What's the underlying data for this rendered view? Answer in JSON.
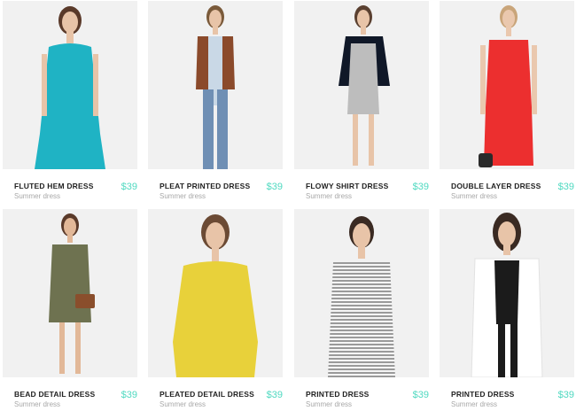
{
  "products": [
    {
      "name": "FLUTED HEM DRESS",
      "subtitle": "Summer dress",
      "price": "$39",
      "dress_color": "#1fb3c4"
    },
    {
      "name": "PLEAT PRINTED DRESS",
      "subtitle": "Summer dress",
      "price": "$39",
      "dress_color": "#8b4a2b"
    },
    {
      "name": "FLOWY SHIRT DRESS",
      "subtitle": "Summer dress",
      "price": "$39",
      "dress_color": "#bdbdbd"
    },
    {
      "name": "DOUBLE LAYER DRESS",
      "subtitle": "Summer dress",
      "price": "$39",
      "dress_color": "#ec2f2f"
    },
    {
      "name": "BEAD DETAIL DRESS",
      "subtitle": "Summer dress",
      "price": "$39",
      "dress_color": "#6e7250"
    },
    {
      "name": "PLEATED DETAIL DRESS",
      "subtitle": "Summer dress",
      "price": "$39",
      "dress_color": "#e8d13a"
    },
    {
      "name": "PRINTED DRESS",
      "subtitle": "Summer dress",
      "price": "$39",
      "dress_color": "#d6d6d6"
    },
    {
      "name": "PRINTED DRESS",
      "subtitle": "Summer dress",
      "price": "$39",
      "dress_color": "#1b1b1b"
    }
  ],
  "colors": {
    "price": "#4fd9c0",
    "photo_background": "#f1f1f1"
  }
}
